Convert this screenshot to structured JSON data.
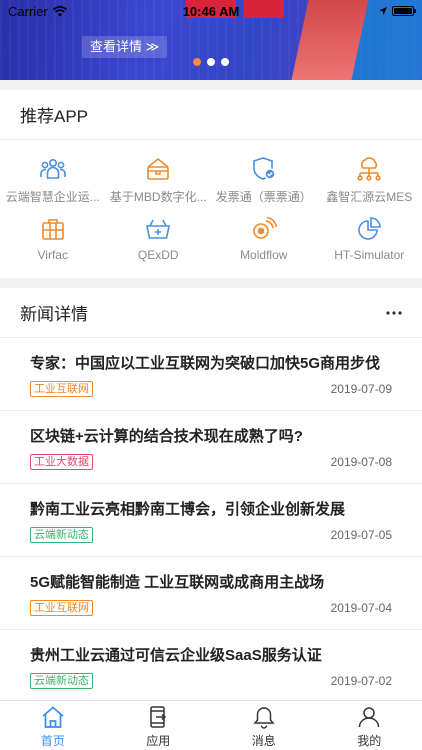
{
  "status_bar": {
    "carrier": "Carrier",
    "time": "10:46 AM",
    "battery_level": 1.0
  },
  "banner": {
    "detail_button": "查看详情 ≫",
    "slides": 3,
    "active_slide": 0
  },
  "apps_section": {
    "title": "推荐APP",
    "items": [
      {
        "label": "云端智慧企业运...",
        "icon": "people-icon"
      },
      {
        "label": "基于MBD数字化...",
        "icon": "toolbox-icon"
      },
      {
        "label": "发票通（票票通）",
        "icon": "shield-check-icon"
      },
      {
        "label": "鑫智汇源云MES",
        "icon": "network-icon"
      },
      {
        "label": "Virfac",
        "icon": "box-icon"
      },
      {
        "label": "QExDD",
        "icon": "cart-icon"
      },
      {
        "label": "Moldflow",
        "icon": "signal-icon"
      },
      {
        "label": "HT-Simulator",
        "icon": "pie-icon"
      }
    ]
  },
  "news_section": {
    "title": "新闻详情",
    "more_icon": "more-icon",
    "items": [
      {
        "headline": "专家：中国应以工业互联网为突破口加快5G商用步伐",
        "tag": "工业互联网",
        "tag_color": "#f08a2a",
        "date": "2019-07-09"
      },
      {
        "headline": "区块链+云计算的结合技术现在成熟了吗?",
        "tag": "工业大数据",
        "tag_color": "#e8486e",
        "date": "2019-07-08"
      },
      {
        "headline": "黔南工业云亮相黔南工博会，引领企业创新发展",
        "tag": "云端新动态",
        "tag_color": "#3fb36b",
        "date": "2019-07-05"
      },
      {
        "headline": "5G赋能智能制造 工业互联网或成商用主战场",
        "tag": "工业互联网",
        "tag_color": "#f08a2a",
        "date": "2019-07-04"
      },
      {
        "headline": "贵州工业云通过可信云企业级SaaS服务认证",
        "tag": "云端新动态",
        "tag_color": "#3fb36b",
        "date": "2019-07-02"
      }
    ]
  },
  "tabbar": {
    "items": [
      {
        "label": "首页",
        "icon": "home-icon",
        "active": true
      },
      {
        "label": "应用",
        "icon": "apps-icon",
        "active": false
      },
      {
        "label": "消息",
        "icon": "bell-icon",
        "active": false
      },
      {
        "label": "我的",
        "icon": "user-icon",
        "active": false
      }
    ]
  },
  "colors": {
    "accent": "#3b8fe8",
    "icon_blue": "#4a8fe0",
    "icon_orange": "#f08a2a"
  }
}
